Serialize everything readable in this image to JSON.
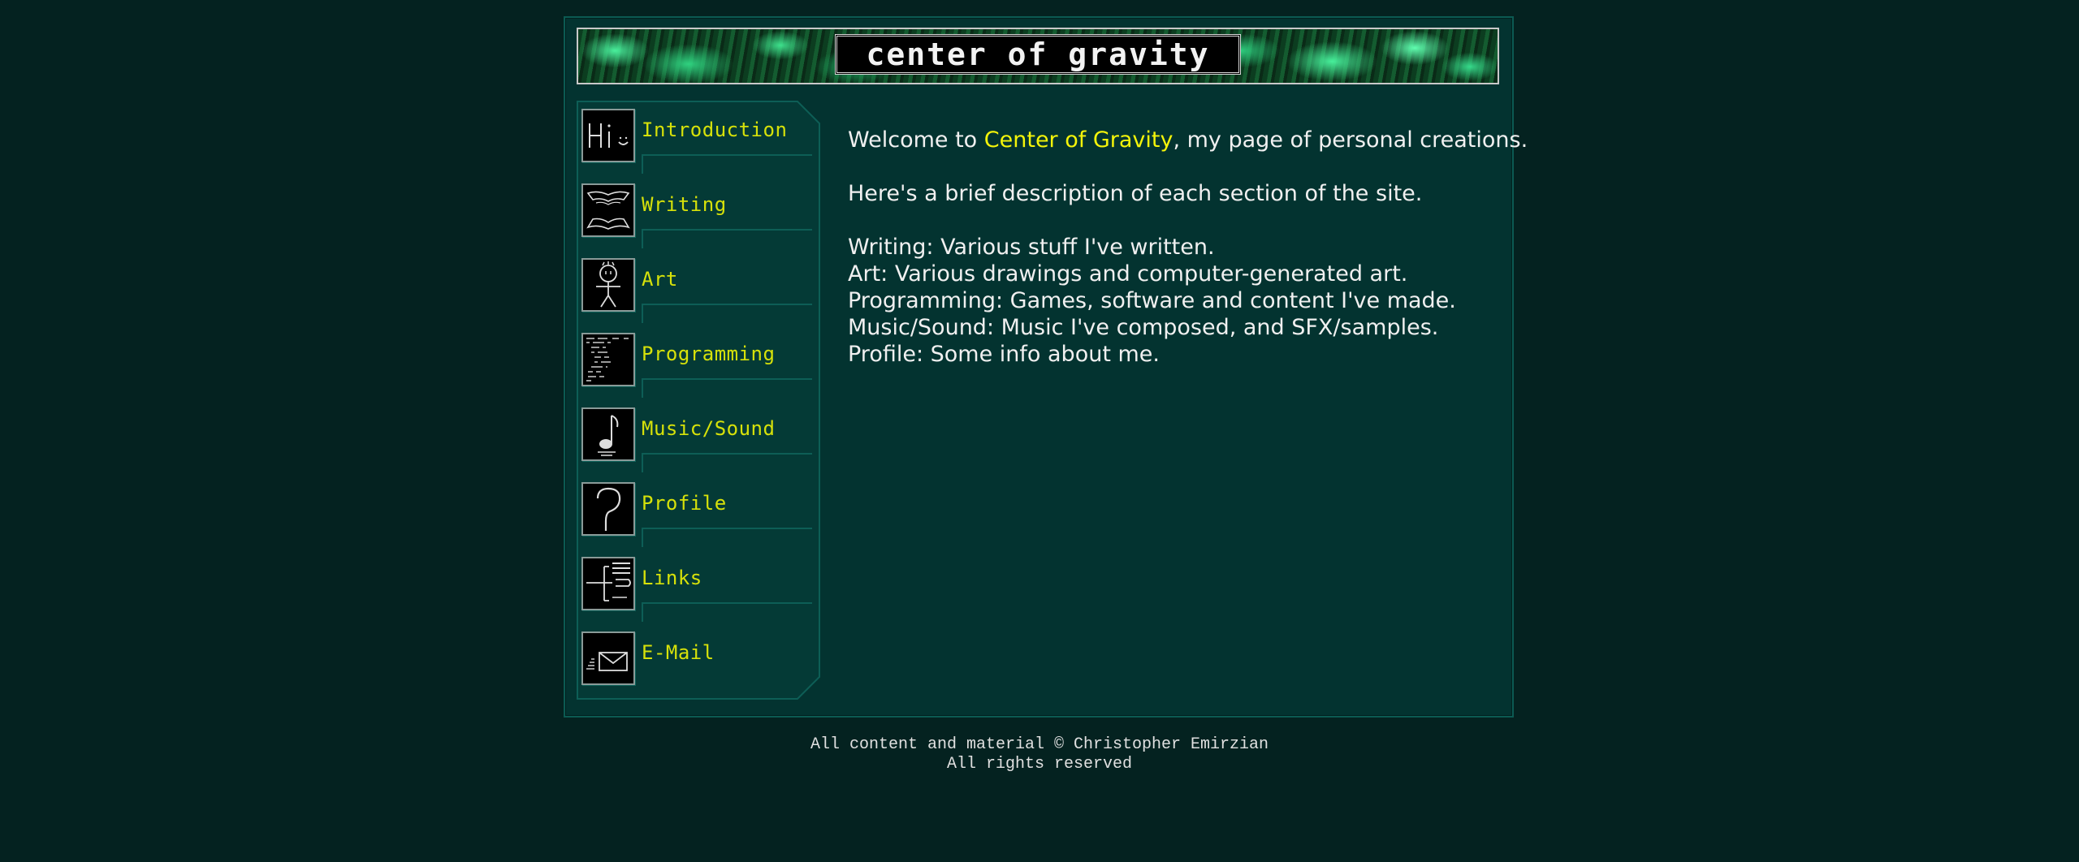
{
  "banner": {
    "title": "center of gravity"
  },
  "nav": {
    "items": [
      {
        "label": "Introduction",
        "icon": "hi-smiley-icon"
      },
      {
        "label": "Writing",
        "icon": "open-book-icon"
      },
      {
        "label": "Art",
        "icon": "stick-figure-icon"
      },
      {
        "label": "Programming",
        "icon": "code-listing-icon"
      },
      {
        "label": "Music/Sound",
        "icon": "music-note-icon"
      },
      {
        "label": "Profile",
        "icon": "question-mark-icon"
      },
      {
        "label": "Links",
        "icon": "link-tree-icon"
      },
      {
        "label": "E-Mail",
        "icon": "envelope-icon"
      }
    ]
  },
  "content": {
    "welcome_prefix": "Welcome to ",
    "welcome_link": "Center of Gravity",
    "welcome_suffix": ", my page of personal creations.",
    "intro": "Here's a brief description of each section of the site.",
    "sections": [
      "Writing: Various stuff I've written.",
      "Art: Various drawings and computer-generated art.",
      "Programming: Games, software and content I've made.",
      "Music/Sound: Music I've composed, and SFX/samples.",
      "Profile: Some info about me."
    ]
  },
  "footer": {
    "line1": "All content and material © Christopher Emirzian",
    "line2": "All rights reserved"
  },
  "colors": {
    "background": "#042220",
    "panel": "#033330",
    "nav_label": "#d6e10a",
    "highlight": "#f4f40a",
    "text": "#f0f0f0"
  }
}
